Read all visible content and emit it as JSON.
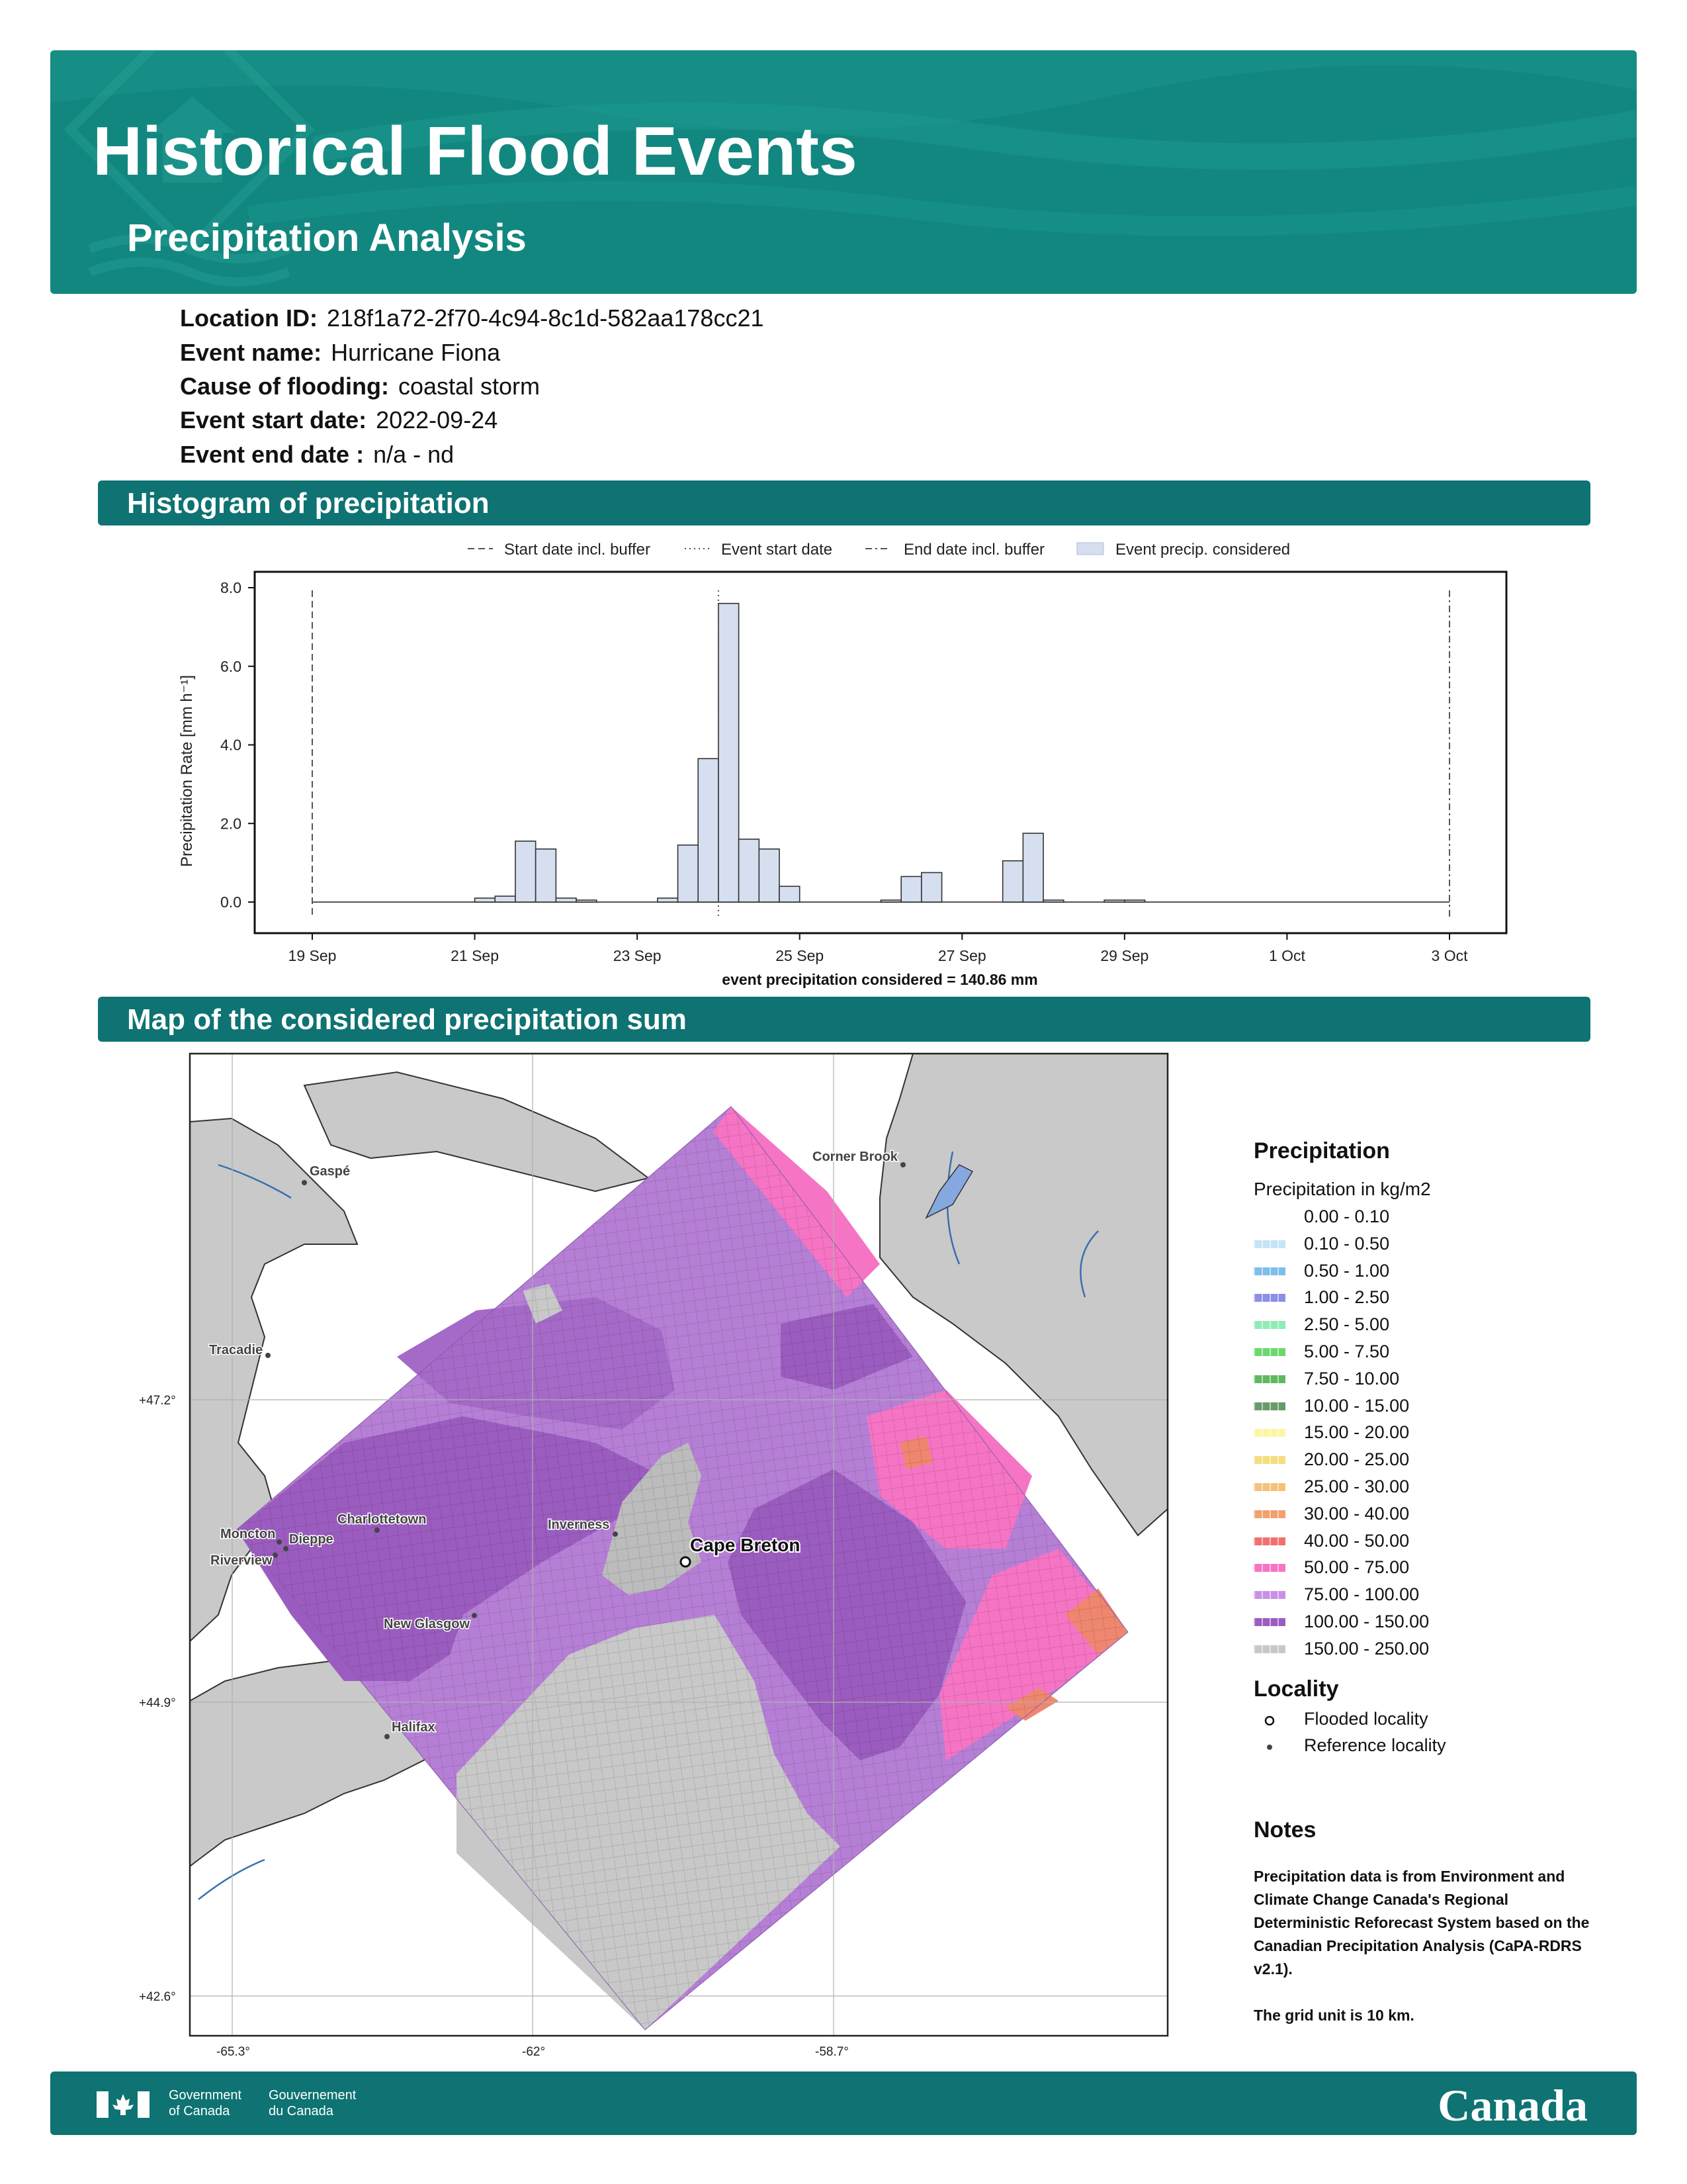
{
  "header": {
    "title": "Historical Flood Events",
    "subtitle": "Precipitation Analysis"
  },
  "event_info": [
    {
      "label": "Location ID:",
      "value": "218f1a72-2f70-4c94-8c1d-582aa178cc21"
    },
    {
      "label": "Event name:",
      "value": "Hurricane Fiona"
    },
    {
      "label": "Cause of flooding:",
      "value": "coastal storm"
    },
    {
      "label": "Event start date:",
      "value": "2022-09-24"
    },
    {
      "label": "Event end date :",
      "value": "n/a - nd"
    }
  ],
  "sections": {
    "histogram": "Histogram of precipitation",
    "map": "Map of the considered precipitation sum"
  },
  "chart_data": {
    "type": "bar",
    "ylabel": "Precipitation Rate [mm h⁻¹]",
    "ylim": [
      0,
      8.0
    ],
    "yticks": [
      0.0,
      2.0,
      4.0,
      6.0,
      8.0
    ],
    "ytick_labels": [
      "0.0",
      "2.0",
      "4.0",
      "6.0",
      "8.0"
    ],
    "xlim_days": [
      18.85,
      3.15
    ],
    "xticks": [
      "19 Sep",
      "21 Sep",
      "23 Sep",
      "25 Sep",
      "27 Sep",
      "29 Sep",
      "1 Oct",
      "3 Oct"
    ],
    "legend": [
      "Start date incl. buffer",
      "Event start date",
      "End date incl. buffer",
      "Event precip. considered"
    ],
    "legend_position": "top",
    "start_date_incl_buffer": "2022-09-19",
    "event_start_date": "2022-09-24",
    "end_date_incl_buffer": "2022-10-03",
    "bin_hours": 6,
    "bins": [
      {
        "start": "2022-09-21 00:00",
        "value": 0.1
      },
      {
        "start": "2022-09-21 06:00",
        "value": 0.15
      },
      {
        "start": "2022-09-21 12:00",
        "value": 1.55
      },
      {
        "start": "2022-09-21 18:00",
        "value": 1.35
      },
      {
        "start": "2022-09-22 00:00",
        "value": 0.1
      },
      {
        "start": "2022-09-22 06:00",
        "value": 0.05
      },
      {
        "start": "2022-09-23 06:00",
        "value": 0.1
      },
      {
        "start": "2022-09-23 12:00",
        "value": 1.45
      },
      {
        "start": "2022-09-23 18:00",
        "value": 3.65
      },
      {
        "start": "2022-09-24 00:00",
        "value": 7.6
      },
      {
        "start": "2022-09-24 06:00",
        "value": 1.6
      },
      {
        "start": "2022-09-24 12:00",
        "value": 1.35
      },
      {
        "start": "2022-09-24 18:00",
        "value": 0.4
      },
      {
        "start": "2022-09-26 00:00",
        "value": 0.05
      },
      {
        "start": "2022-09-26 06:00",
        "value": 0.65
      },
      {
        "start": "2022-09-26 12:00",
        "value": 0.75
      },
      {
        "start": "2022-09-27 12:00",
        "value": 1.05
      },
      {
        "start": "2022-09-27 18:00",
        "value": 1.75
      },
      {
        "start": "2022-09-28 00:00",
        "value": 0.05
      },
      {
        "start": "2022-09-28 18:00",
        "value": 0.05
      },
      {
        "start": "2022-09-29 00:00",
        "value": 0.05
      }
    ],
    "caption": "event precipitation considered = 140.86 mm"
  },
  "map": {
    "lat_labels": [
      "+47.2°",
      "+44.9°",
      "+42.6°"
    ],
    "lon_labels": [
      "-65.3°",
      "-62°",
      "-58.7°"
    ],
    "places": [
      {
        "name": "Gaspé",
        "kind": "reference"
      },
      {
        "name": "Corner Brook",
        "kind": "reference"
      },
      {
        "name": "Tracadie",
        "kind": "reference"
      },
      {
        "name": "Charlottetown",
        "kind": "reference"
      },
      {
        "name": "Inverness",
        "kind": "reference"
      },
      {
        "name": "Moncton",
        "kind": "reference"
      },
      {
        "name": "Dieppe",
        "kind": "reference"
      },
      {
        "name": "Riverview",
        "kind": "reference"
      },
      {
        "name": "New Glasgow",
        "kind": "reference"
      },
      {
        "name": "Halifax",
        "kind": "reference"
      },
      {
        "name": "Cape Breton",
        "kind": "flooded"
      }
    ]
  },
  "legend": {
    "title": "Precipitation",
    "subtitle": "Precipitation in kg/m2",
    "bins": [
      {
        "label": "0.00 - 0.10",
        "color": "#ffffff"
      },
      {
        "label": "0.10 - 0.50",
        "color": "#c6e4f6"
      },
      {
        "label": "0.50 - 1.00",
        "color": "#7fbdea"
      },
      {
        "label": "1.00 - 2.50",
        "color": "#8c8fe6"
      },
      {
        "label": "2.50 - 5.00",
        "color": "#90ecb4"
      },
      {
        "label": "5.00 - 7.50",
        "color": "#6ed86e"
      },
      {
        "label": "7.50 - 10.00",
        "color": "#5fb85f"
      },
      {
        "label": "10.00 - 15.00",
        "color": "#6a9a6a"
      },
      {
        "label": "15.00 - 20.00",
        "color": "#fbf6a6"
      },
      {
        "label": "20.00 - 25.00",
        "color": "#f5dd80"
      },
      {
        "label": "25.00 - 30.00",
        "color": "#f5c27a"
      },
      {
        "label": "30.00 - 40.00",
        "color": "#f1a070"
      },
      {
        "label": "40.00 - 50.00",
        "color": "#f07070"
      },
      {
        "label": "50.00 - 75.00",
        "color": "#f774c4"
      },
      {
        "label": "75.00 - 100.00",
        "color": "#c891e8"
      },
      {
        "label": "100.00 - 150.00",
        "color": "#9b5cbf"
      },
      {
        "label": "150.00 - 250.00",
        "color": "#c8c8c8"
      }
    ],
    "locality_title": "Locality",
    "flooded_label": "Flooded locality",
    "reference_label": "Reference locality"
  },
  "notes": {
    "title": "Notes",
    "text1": "Precipitation data is from Environment and Climate Change Canada's Regional Deterministic Reforecast System based on the Canadian Precipitation Analysis (CaPA-RDRS v2.1).",
    "text2": "The grid unit is 10 km."
  },
  "footer": {
    "gov_en_1": "Government",
    "gov_en_2": "of Canada",
    "gov_fr_1": "Gouvernement",
    "gov_fr_2": "du Canada",
    "wordmark": "Canada"
  },
  "colors": {
    "banner": "#12877f",
    "section_bar": "#0e7372",
    "histogram_fill": "#d5dff0"
  }
}
